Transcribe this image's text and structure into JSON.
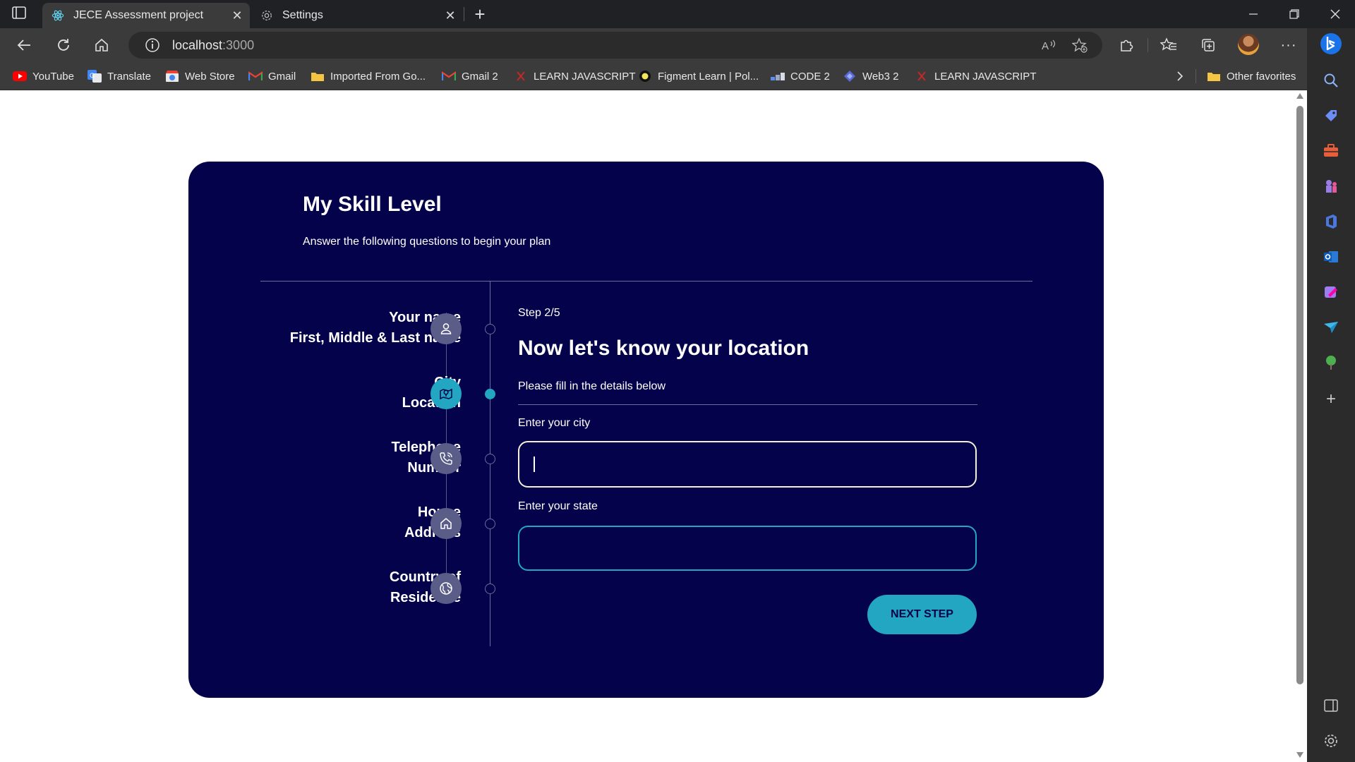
{
  "browser": {
    "tabs": [
      {
        "title": "JECE Assessment project",
        "icon": "react-icon",
        "active": true
      },
      {
        "title": "Settings",
        "icon": "gear-icon",
        "active": false
      }
    ],
    "url_host": "localhost",
    "url_port": ":3000",
    "bookmarks": [
      {
        "label": "YouTube",
        "icon": "youtube-icon"
      },
      {
        "label": "Translate",
        "icon": "translate-icon"
      },
      {
        "label": "Web Store",
        "icon": "webstore-icon"
      },
      {
        "label": "Gmail",
        "icon": "gmail-icon"
      },
      {
        "label": "Imported From Go...",
        "icon": "folder-icon"
      },
      {
        "label": "Gmail 2",
        "icon": "gmail-icon"
      },
      {
        "label": "LEARN JAVASCRIPT",
        "icon": "x-logo-icon"
      },
      {
        "label": "Figment Learn | Pol...",
        "icon": "figment-icon"
      },
      {
        "label": "CODE 2",
        "icon": "code-icon"
      },
      {
        "label": "Web3 2",
        "icon": "web3-icon"
      },
      {
        "label": "LEARN JAVASCRIPT",
        "icon": "x-logo-icon"
      }
    ],
    "other_favorites": "Other favorites"
  },
  "page": {
    "title": "My Skill Level",
    "subtitle": "Answer the following questions to begin your plan",
    "steps": [
      {
        "line1": "Your name",
        "line2": "First, Middle & Last name",
        "icon": "user-icon",
        "active": false
      },
      {
        "line1": "City",
        "line2": "Location",
        "icon": "map-pin-icon",
        "active": true
      },
      {
        "line1": "Telephone",
        "line2": "Number",
        "icon": "phone-icon",
        "active": false
      },
      {
        "line1": "House",
        "line2": "Address",
        "icon": "home-icon",
        "active": false
      },
      {
        "line1": "Country of",
        "line2": "Residence",
        "icon": "globe-icon",
        "active": false
      }
    ],
    "form": {
      "step_count": "Step 2/5",
      "heading": "Now let's know your location",
      "hint": "Please fill in the details below",
      "city_label": "Enter your city",
      "city_value": "",
      "state_label": "Enter your state",
      "state_value": "",
      "next_label": "NEXT STEP"
    },
    "colors": {
      "card_bg": "#03024a",
      "accent": "#22a6c2",
      "inactive_step": "#5a5d88"
    }
  }
}
